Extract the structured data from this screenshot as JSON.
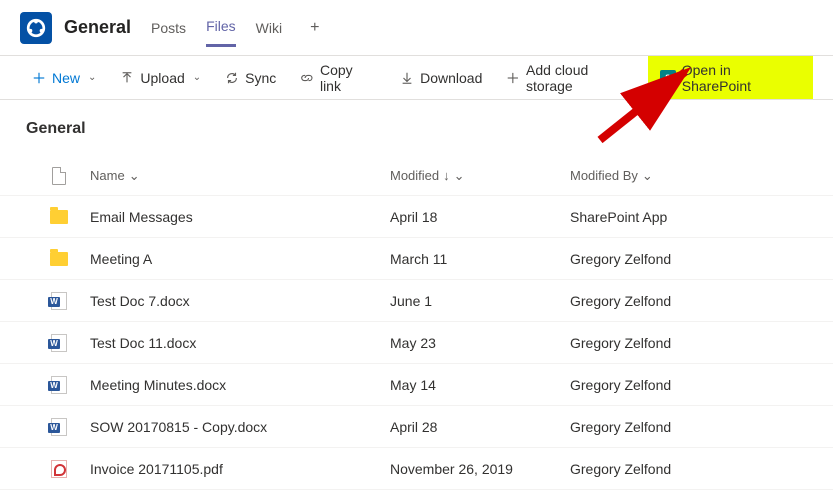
{
  "header": {
    "channel": "General",
    "tabs": [
      "Posts",
      "Files",
      "Wiki"
    ],
    "active_tab": "Files"
  },
  "toolbar": {
    "new": "New",
    "upload": "Upload",
    "sync": "Sync",
    "copylink": "Copy link",
    "download": "Download",
    "addcloud": "Add cloud storage",
    "sharepoint": "Open in SharePoint"
  },
  "breadcrumb": "General",
  "columns": {
    "name": "Name",
    "modified": "Modified",
    "modifiedby": "Modified By"
  },
  "files": [
    {
      "icon": "folder",
      "name": "Email Messages",
      "modified": "April 18",
      "by": "SharePoint App"
    },
    {
      "icon": "folder",
      "name": "Meeting A",
      "modified": "March 11",
      "by": "Gregory Zelfond"
    },
    {
      "icon": "docx",
      "name": "Test Doc 7.docx",
      "modified": "June 1",
      "by": "Gregory Zelfond"
    },
    {
      "icon": "docx",
      "name": "Test Doc 11.docx",
      "modified": "May 23",
      "by": "Gregory Zelfond"
    },
    {
      "icon": "docx",
      "name": "Meeting Minutes.docx",
      "modified": "May 14",
      "by": "Gregory Zelfond"
    },
    {
      "icon": "docx",
      "name": "SOW 20170815 - Copy.docx",
      "modified": "April 28",
      "by": "Gregory Zelfond"
    },
    {
      "icon": "pdf",
      "name": "Invoice 20171105.pdf",
      "modified": "November 26, 2019",
      "by": "Gregory Zelfond"
    }
  ]
}
